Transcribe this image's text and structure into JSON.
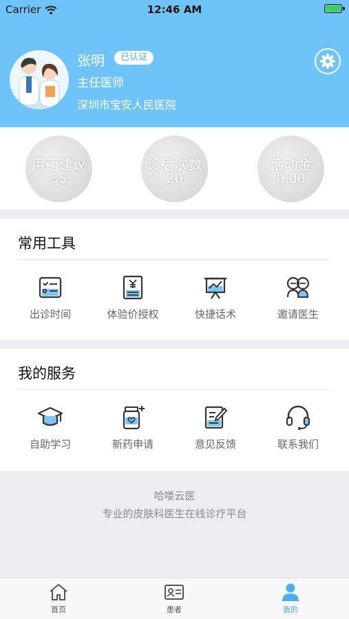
{
  "status_bar": {
    "carrier": "Carrier",
    "time": "12:46 AM"
  },
  "profile": {
    "name": "张明",
    "verified": "已认证",
    "title": "主任医师",
    "hospital": "深圳市宝安人民医院"
  },
  "stats": [
    {
      "label": "用药建议",
      "value": "55"
    },
    {
      "label": "诊后次数",
      "value": "20"
    },
    {
      "label": "活动金",
      "value": "0.00"
    }
  ],
  "tools": {
    "title": "常用工具",
    "items": [
      {
        "label": "出诊时间",
        "icon": "schedule-icon"
      },
      {
        "label": "体验价授权",
        "icon": "price-doc-icon"
      },
      {
        "label": "快捷话术",
        "icon": "presentation-icon"
      },
      {
        "label": "邀请医生",
        "icon": "invite-doctor-icon"
      }
    ]
  },
  "services": {
    "title": "我的服务",
    "items": [
      {
        "label": "自助学习",
        "icon": "graduation-cap-icon"
      },
      {
        "label": "新药申请",
        "icon": "medicine-bottle-icon"
      },
      {
        "label": "意见反馈",
        "icon": "feedback-edit-icon"
      },
      {
        "label": "联系我们",
        "icon": "headset-icon"
      }
    ]
  },
  "footer": {
    "name": "哈喽云医",
    "description": "专业的皮肤科医生在线诊疗平台"
  },
  "tabbar": {
    "items": [
      {
        "label": "首页",
        "icon": "home-icon"
      },
      {
        "label": "患者",
        "icon": "patient-card-icon"
      },
      {
        "label": "我的",
        "icon": "person-icon"
      }
    ]
  },
  "colors": {
    "header": "#6ec3f8",
    "accent": "#4aaef0",
    "icon_stroke": "#333333",
    "icon_fill": "#7cc6f2"
  }
}
